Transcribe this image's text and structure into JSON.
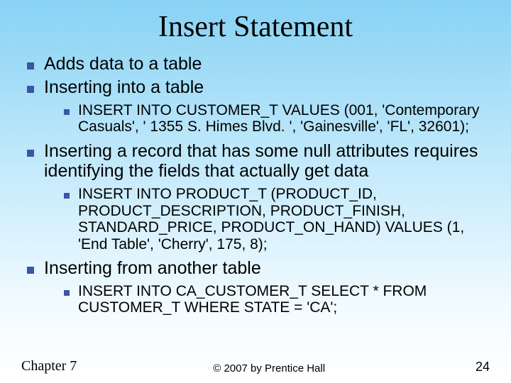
{
  "title": "Insert Statement",
  "bullets": {
    "b1": "Adds data to a table",
    "b2": "Inserting into a table",
    "b2_sub": "INSERT INTO CUSTOMER_T VALUES (001, 'Contemporary Casuals', ' 1355 S. Himes Blvd. ', 'Gainesville', 'FL', 32601);",
    "b3": "Inserting a record that has some null attributes requires identifying the fields that actually get data",
    "b3_sub": "INSERT INTO PRODUCT_T (PRODUCT_ID, PRODUCT_DESCRIPTION, PRODUCT_FINISH, STANDARD_PRICE, PRODUCT_ON_HAND) VALUES (1, 'End Table', 'Cherry', 175, 8);",
    "b4": "Inserting from another table",
    "b4_sub": "INSERT INTO CA_CUSTOMER_T SELECT * FROM CUSTOMER_T WHERE STATE = 'CA';"
  },
  "footer": {
    "chapter": "Chapter 7",
    "copyright": "© 2007 by Prentice Hall",
    "page": "24"
  }
}
